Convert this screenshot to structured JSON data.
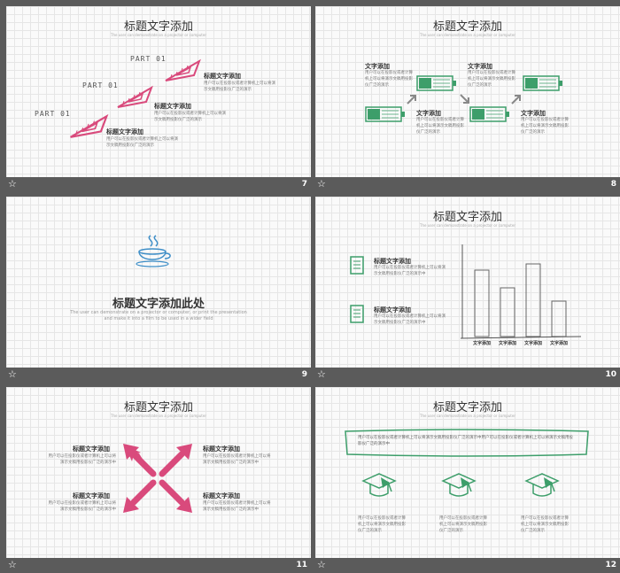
{
  "title": "标题文字添加",
  "subtitle": "The user can demonstrate on a projector or computer",
  "star_icon": "star-icon",
  "colors": {
    "pink": "#d94a7c",
    "green": "#3d9e6a",
    "blue": "#3f8fc8"
  },
  "slide7": {
    "number": "7",
    "parts": [
      "PART 01",
      "PART 01",
      "PART 01"
    ],
    "blocks": [
      {
        "heading": "标题文字添加",
        "body": "用户可以在投影仪或者计算机上可以将演示文稿用投影仪广泛的演示"
      },
      {
        "heading": "标题文字添加",
        "body": "用户可以在投影仪或者计算机上可以将演示文稿用投影仪广泛的演示"
      },
      {
        "heading": "标题文字添加",
        "body": "用户可以在投影仪或者计算机上可以将演示文稿用投影仪广泛的演示"
      }
    ]
  },
  "slide8": {
    "number": "8",
    "blocks": [
      {
        "heading": "文字添加",
        "body": "用户可以在投影仪或者计算机上可以将演示文稿用投影仪广泛的演示"
      },
      {
        "heading": "文字添加",
        "body": "用户可以在投影仪或者计算机上可以将演示文稿用投影仪广泛的演示"
      },
      {
        "heading": "文字添加",
        "body": "用户可以在投影仪或者计算机上可以将演示文稿用投影仪广泛的演示"
      },
      {
        "heading": "文字添加",
        "body": "用户可以在投影仪或者计算机上可以将演示文稿用投影仪广泛的演示"
      }
    ]
  },
  "slide9": {
    "number": "9",
    "title": "标题文字添加此处",
    "sub1": "The user can demonstrate on a projector or computer, or print the presentation",
    "sub2": "and make it into a film to be used in a wider field"
  },
  "slide10": {
    "number": "10",
    "blocks": [
      {
        "heading": "标题文字添加",
        "body": "用户可以在投影仪或者计算机上可以将演示文稿用投影仪广泛的演示中"
      },
      {
        "heading": "标题文字添加",
        "body": "用户可以在投影仪或者计算机上可以将演示文稿用投影仪广泛的演示中"
      }
    ],
    "axis_labels": [
      "文字添加",
      "文字添加",
      "文字添加",
      "文字添加"
    ]
  },
  "chart_data": {
    "type": "bar",
    "categories": [
      "文字添加",
      "文字添加",
      "文字添加",
      "文字添加"
    ],
    "values": [
      75,
      55,
      82,
      40
    ],
    "ylim": [
      0,
      100
    ],
    "title": "",
    "xlabel": "",
    "ylabel": ""
  },
  "slide11": {
    "number": "11",
    "blocks": [
      {
        "heading": "标题文字添加",
        "body": "用户可以在投影仪或者计算机上可以将演示文稿用投影仪广泛的演示中"
      },
      {
        "heading": "标题文字添加",
        "body": "用户可以在投影仪或者计算机上可以将演示文稿用投影仪广泛的演示中"
      },
      {
        "heading": "标题文字添加",
        "body": "用户可以在投影仪或者计算机上可以将演示文稿用投影仪广泛的演示中"
      },
      {
        "heading": "标题文字添加",
        "body": "用户可以在投影仪或者计算机上可以将演示文稿用投影仪广泛的演示中"
      }
    ]
  },
  "slide12": {
    "number": "12",
    "banner": "用户可以在投影仪或者计算机上可以将演示文稿用投影仪广泛的演示中用户可以在投影仪或者计算机上可以将演示文稿用投影仪广泛的演示中",
    "captions": [
      "用户可以在投影仪或者计算机上可以将演示文稿用投影仪广泛的演示",
      "用户可以在投影仪或者计算机上可以将演示文稿用投影仪广泛的演示",
      "用户可以在投影仪或者计算机上可以将演示文稿用投影仪广泛的演示"
    ]
  }
}
